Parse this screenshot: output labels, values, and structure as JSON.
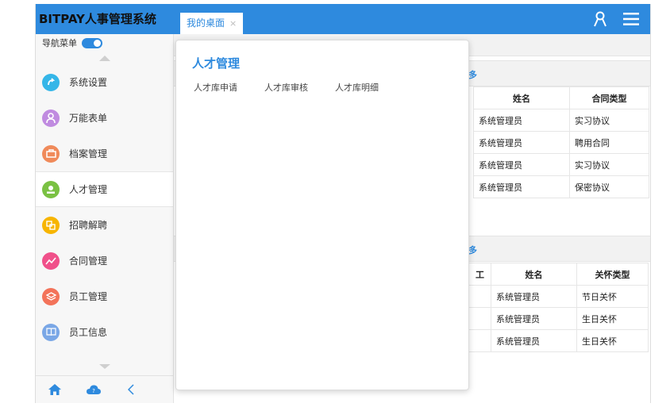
{
  "app": {
    "title": "BITPAY人事管理系统"
  },
  "tabs": [
    {
      "label": "我的桌面",
      "close": "×"
    }
  ],
  "sidebar": {
    "toggle_label": "导航菜单",
    "items": [
      {
        "label": "系统设置",
        "icon": "settings-icon",
        "color": "#35b6e8"
      },
      {
        "label": "万能表单",
        "icon": "user-form-icon",
        "color": "#c08be0"
      },
      {
        "label": "档案管理",
        "icon": "briefcase-icon",
        "color": "#f08a5a"
      },
      {
        "label": "人才管理",
        "icon": "talent-icon",
        "color": "#7ac143",
        "active": true
      },
      {
        "label": "招聘解聘",
        "icon": "recruit-icon",
        "color": "#f7b500"
      },
      {
        "label": "合同管理",
        "icon": "chart-line-icon",
        "color": "#f0508a"
      },
      {
        "label": "员工管理",
        "icon": "layers-icon",
        "color": "#f3735a"
      },
      {
        "label": "员工信息",
        "icon": "book-icon",
        "color": "#7aa7e6"
      }
    ]
  },
  "popup": {
    "title": "人才管理",
    "links": [
      "人才库申请",
      "人才库审核",
      "人才库明细"
    ]
  },
  "panel1": {
    "more": "多",
    "headers": [
      "姓名",
      "合同类型"
    ],
    "rows": [
      [
        "系统管理员",
        "实习协议"
      ],
      [
        "系统管理员",
        "聘用合同"
      ],
      [
        "系统管理员",
        "实习协议"
      ],
      [
        "系统管理员",
        "保密协议"
      ]
    ]
  },
  "panel2": {
    "more": "多",
    "headers": [
      "工",
      "姓名",
      "关怀类型"
    ],
    "rows": [
      [
        "系统管理员",
        "节日关怀"
      ],
      [
        "系统管理员",
        "生日关怀"
      ],
      [
        "系统管理员",
        "生日关怀"
      ]
    ]
  },
  "colors": {
    "accent": "#2e8ade"
  }
}
